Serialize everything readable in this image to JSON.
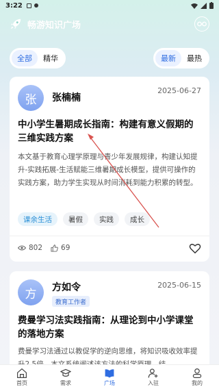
{
  "status_bar": {
    "time": "3:22"
  },
  "app_bar": {
    "title": "畅游知识广场",
    "icon": "rocket-icon",
    "action_icon": "glasses-icon"
  },
  "filters": {
    "category": [
      {
        "label": "全部",
        "active": true
      },
      {
        "label": "精华",
        "active": false
      }
    ],
    "sort": [
      {
        "label": "最新",
        "active": true
      },
      {
        "label": "最热",
        "active": false
      }
    ]
  },
  "posts": [
    {
      "avatar_char": "张",
      "author": "张楠楠",
      "role": "",
      "date": "2025-06-27",
      "title": "中小学生暑期成长指南：构建有意义假期的三维实践方案",
      "description": "本文基于教育心理学原理与青少年发展规律，构建认知提升-实践拓展-生活赋能三维暑期成长模型，提供可操作的实践方案，助力学生实现从时间消耗到能力积累的转型。",
      "tags": [
        "课余生活",
        "暑假",
        "实践",
        "成长"
      ],
      "views": "802",
      "likes": "69"
    },
    {
      "avatar_char": "方",
      "author": "方如令",
      "role": "教育工作者",
      "date": "2025-06-15",
      "title": "费曼学习法实践指南：从理论到中小学课堂的落地方案",
      "description": "费曼学习法通过以教促学的逆向思维，将知识吸收效率提升2.5倍。本文系统阐述该方法的科学原理，结"
    }
  ],
  "bottom_nav": [
    {
      "label": "首页",
      "icon": "home-icon",
      "active": false
    },
    {
      "label": "需求",
      "icon": "graduation-cap-icon",
      "active": false
    },
    {
      "label": "广场",
      "icon": "book-icon",
      "active": true
    },
    {
      "label": "入驻",
      "icon": "user-add-icon",
      "active": false
    },
    {
      "label": "我的",
      "icon": "profile-icon",
      "active": false
    }
  ],
  "colors": {
    "accent": "#2f6de1",
    "tag_primary": "#2a8fd6",
    "annotation_arrow": "#d9534f"
  }
}
